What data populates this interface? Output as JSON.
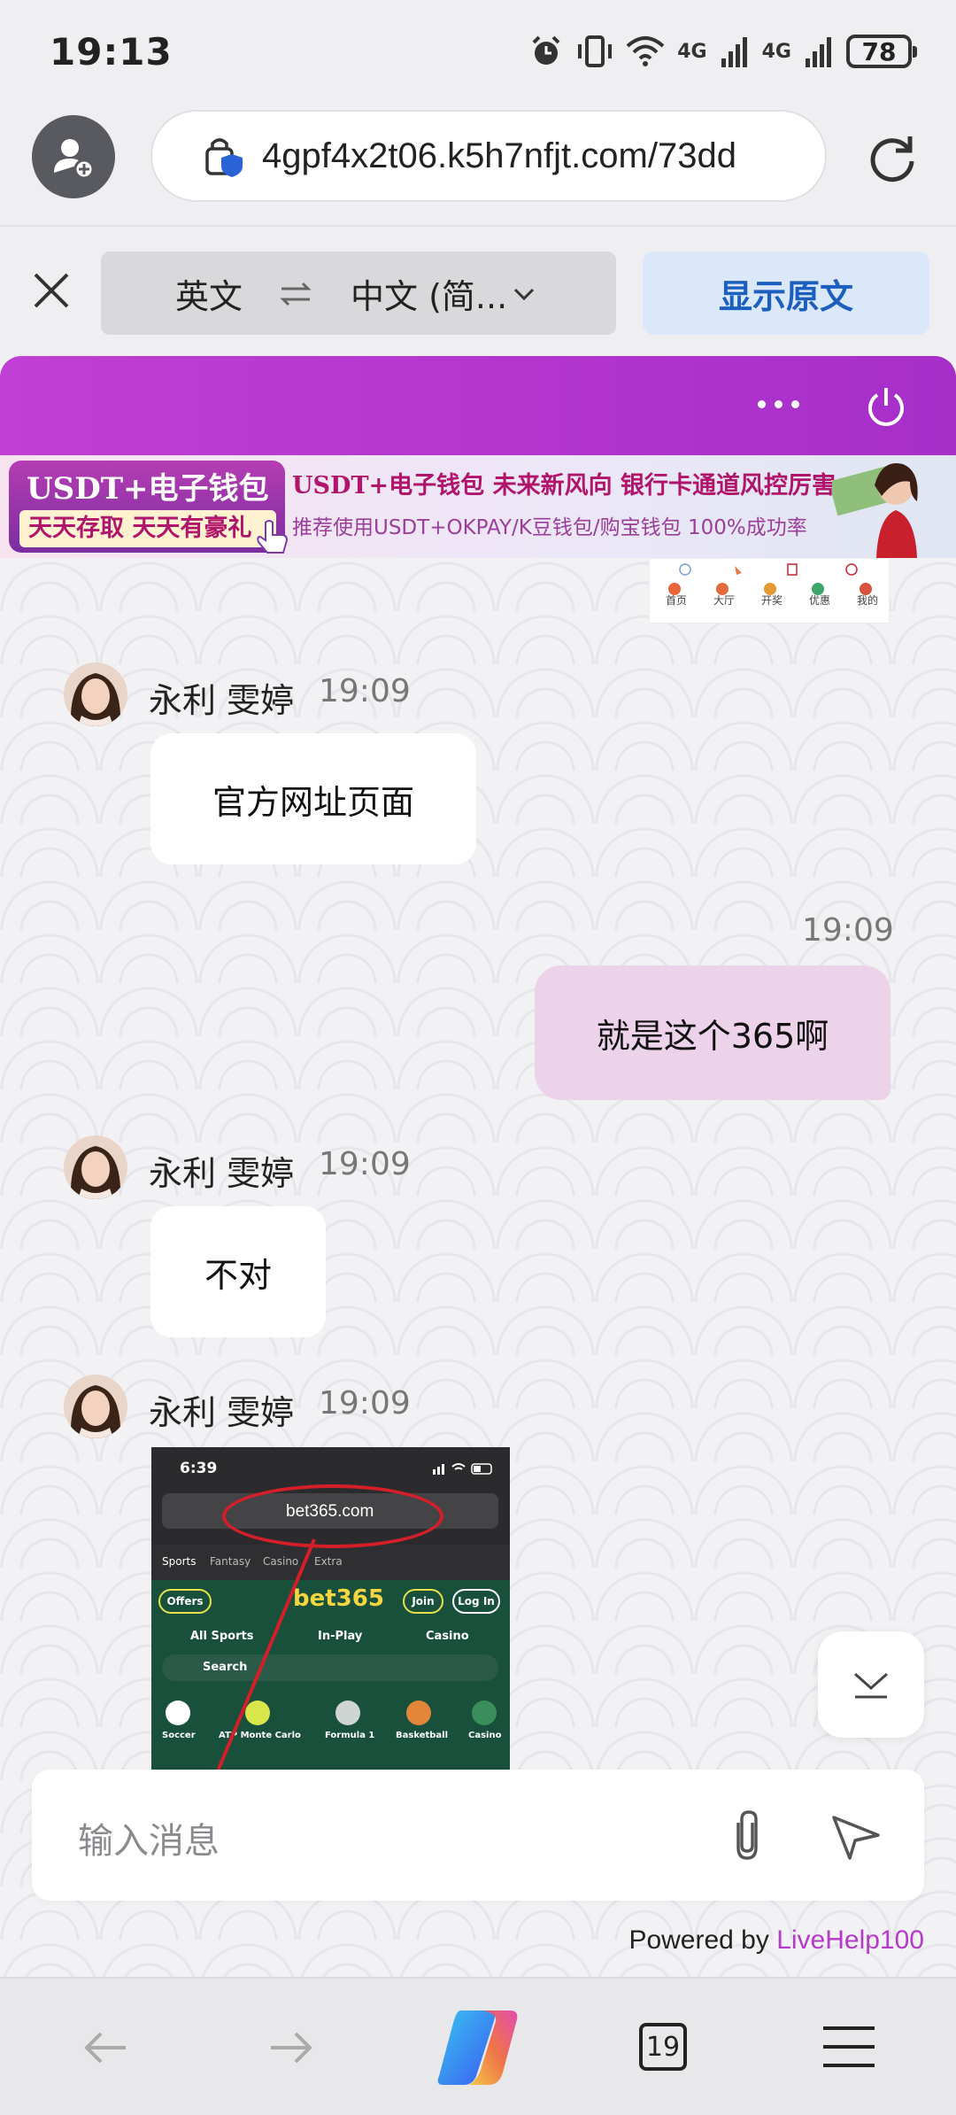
{
  "status_bar": {
    "time": "19:13",
    "network_1": "4G",
    "network_2": "4G",
    "battery": "78"
  },
  "address_bar": {
    "url": "4gpf4x2t06.k5h7nfjt.com/73dd"
  },
  "translate_bar": {
    "source_lang": "英文",
    "target_lang": "中文 (简...",
    "show_original": "显示原文"
  },
  "banner": {
    "left_line1": "USDT+电子钱包",
    "left_line2": "天天存取 天天有豪礼",
    "right_line1": "USDT+电子钱包  未来新风向  银行卡通道风控厉害",
    "right_line2": "推荐使用USDT+OKPAY/K豆钱包/购宝钱包  100%成功率"
  },
  "mini_nav": [
    "首页",
    "大厅",
    "开奖",
    "优惠",
    "我的"
  ],
  "messages": [
    {
      "sender": "永利 雯婷",
      "time": "19:09",
      "text": "官方网址页面"
    },
    {
      "time": "19:09",
      "text": "就是这个365啊"
    },
    {
      "sender": "永利 雯婷",
      "time": "19:09",
      "text": "不对"
    },
    {
      "sender": "永利 雯婷",
      "time": "19:09"
    }
  ],
  "screenshot": {
    "time": "6:39",
    "url": "bet365.com",
    "tabs": [
      "Sports",
      "Fantasy",
      "Casino",
      "Extra"
    ],
    "offers": "Offers",
    "logo": "bet365",
    "join": "Join",
    "login": "Log In",
    "nav": [
      "All Sports",
      "In-Play",
      "Casino"
    ],
    "search": "Search",
    "sports": [
      "Soccer",
      "ATP Monte Carlo",
      "Formula 1",
      "Basketball",
      "Casino"
    ]
  },
  "input": {
    "placeholder": "输入消息"
  },
  "powered": {
    "prefix": "Powered by ",
    "brand": "LiveHelp100"
  },
  "bottom_nav": {
    "tab_count": "19"
  },
  "colors": {
    "header": "#b438cf",
    "outgoing_bubble": "#ecd3ea",
    "accent_blue": "#1d5fbf",
    "brand": "#b43ac7"
  }
}
